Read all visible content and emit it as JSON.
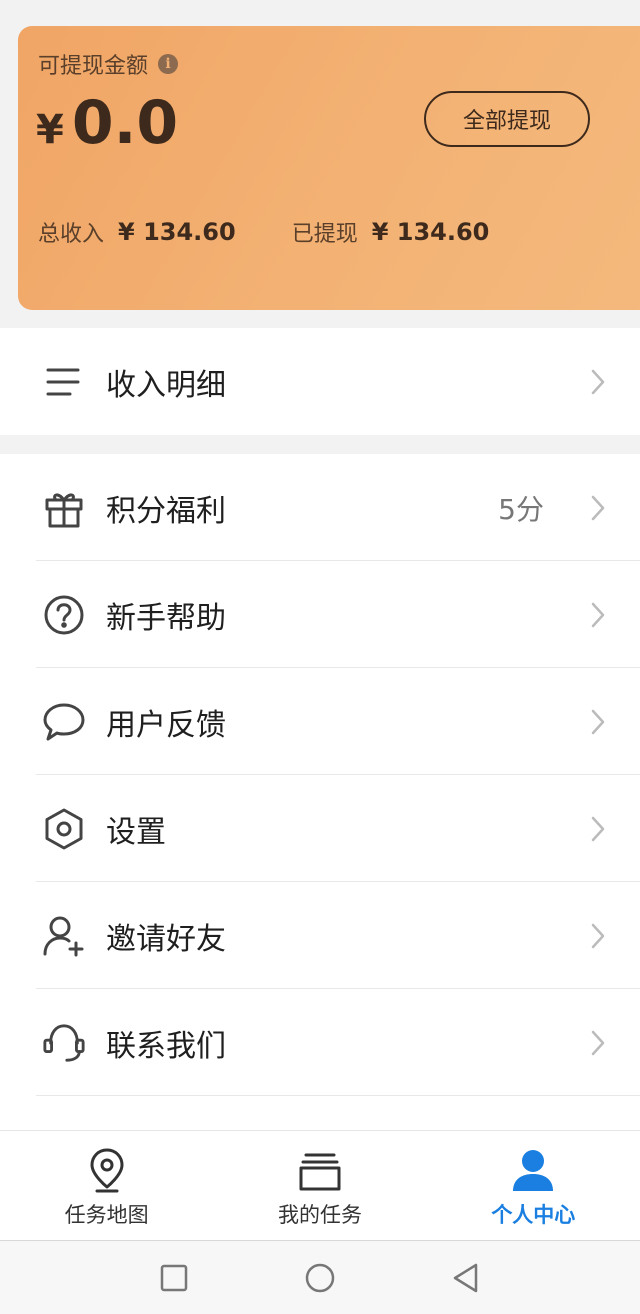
{
  "balance": {
    "label": "可提现金额",
    "currency": "¥",
    "amount": "0.0",
    "withdraw_label": "全部提现",
    "total_income_label": "总收入",
    "total_income_value": "¥ 134.60",
    "withdrawn_label": "已提现",
    "withdrawn_value": "¥ 134.60"
  },
  "menu": {
    "income_detail": "收入明细",
    "items": [
      {
        "label": "积分福利",
        "value": "5分",
        "icon": "gift-icon"
      },
      {
        "label": "新手帮助",
        "value": "",
        "icon": "help-circle-icon"
      },
      {
        "label": "用户反馈",
        "value": "",
        "icon": "chat-bubble-icon"
      },
      {
        "label": "设置",
        "value": "",
        "icon": "settings-hexagon-icon"
      },
      {
        "label": "邀请好友",
        "value": "",
        "icon": "add-user-icon"
      },
      {
        "label": "联系我们",
        "value": "",
        "icon": "headset-icon"
      }
    ]
  },
  "tabs": [
    {
      "label": "任务地图",
      "icon": "map-pin-icon"
    },
    {
      "label": "我的任务",
      "icon": "task-stack-icon"
    },
    {
      "label": "个人中心",
      "icon": "person-icon",
      "active": true
    }
  ],
  "colors": {
    "accent": "#1a7fe0",
    "card": "#f2a96b",
    "icon": "#444444"
  }
}
